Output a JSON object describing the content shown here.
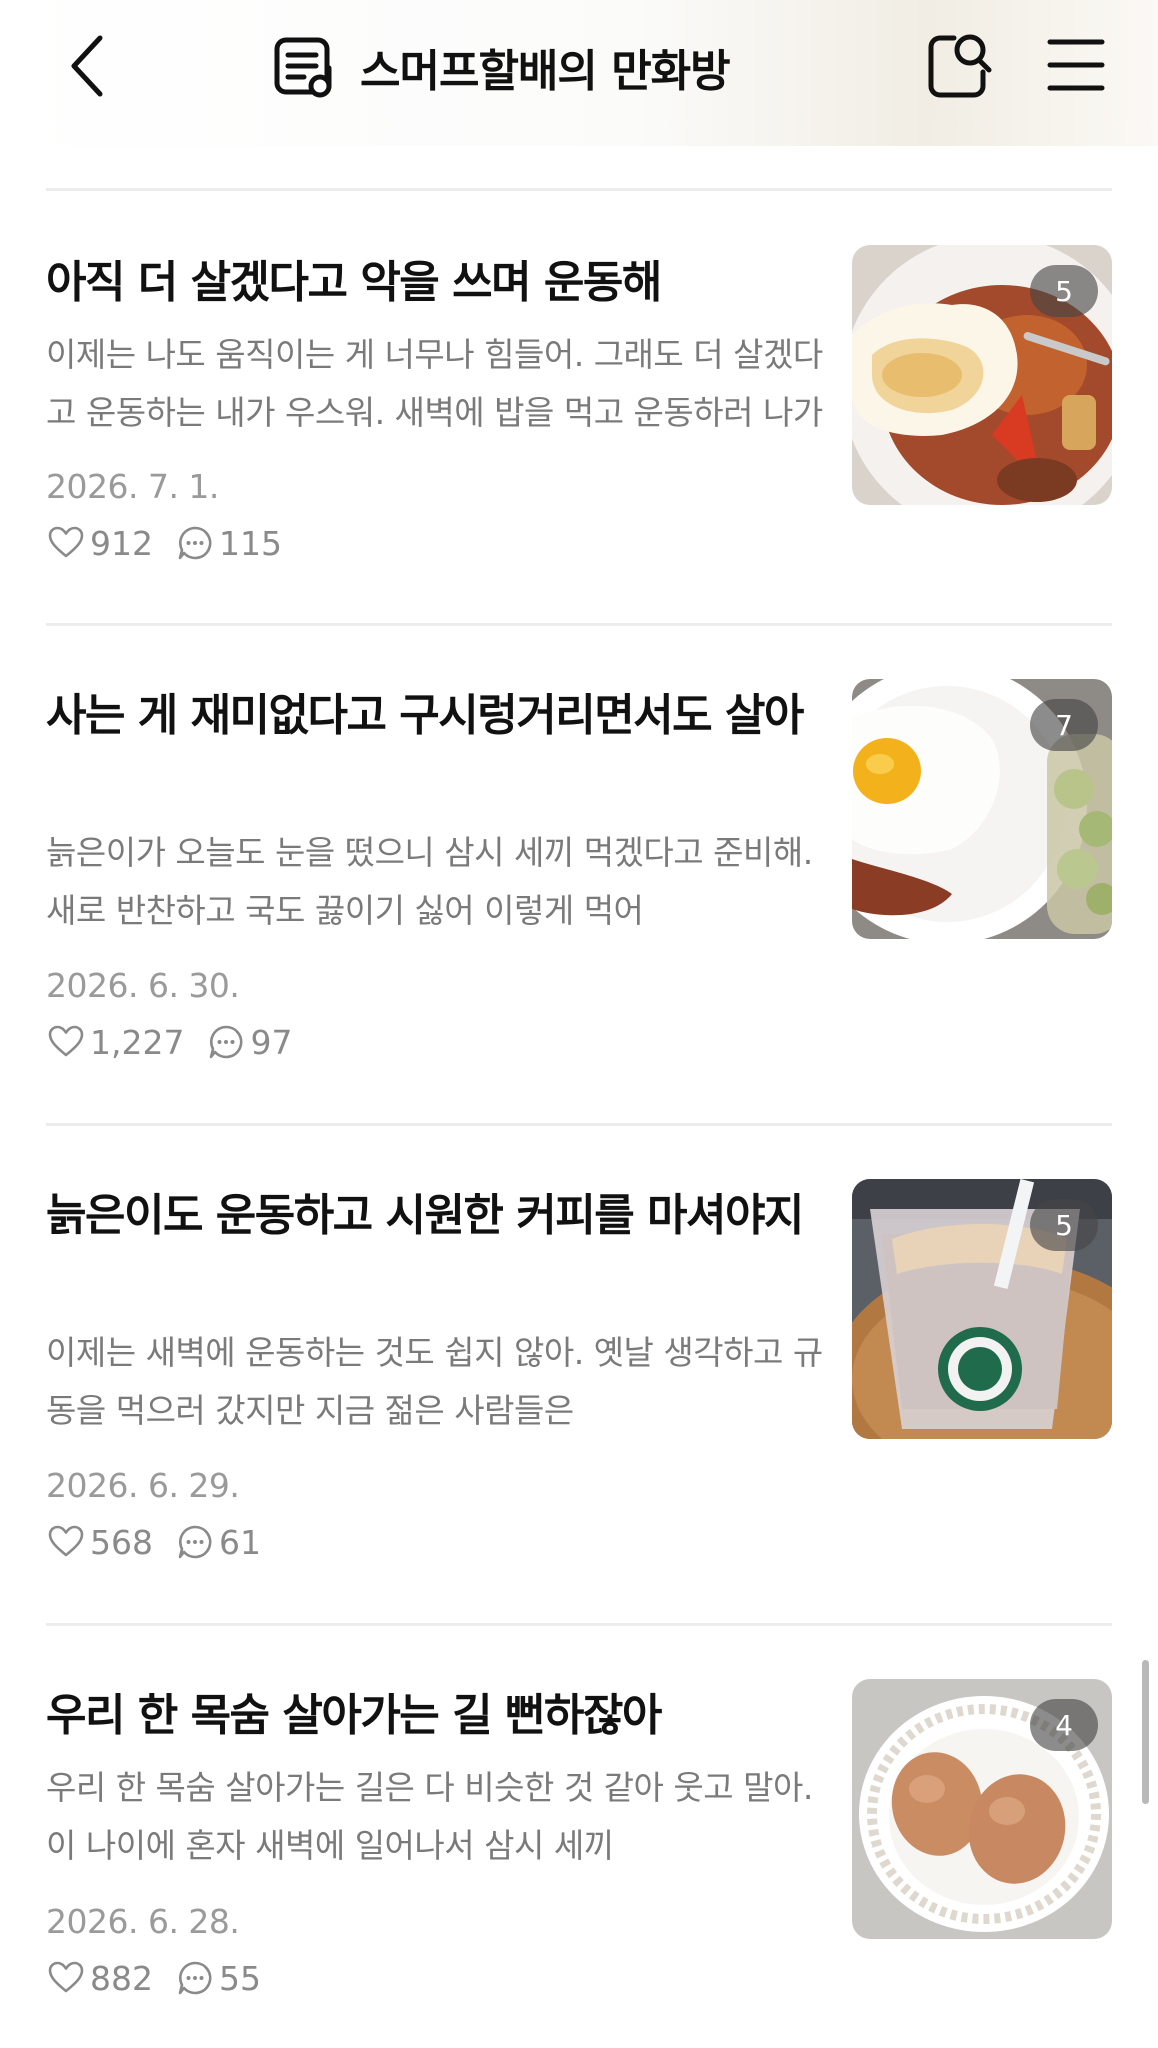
{
  "header": {
    "title": "스머프할배의 만화방",
    "back_icon": "chevron-left-icon",
    "list_icon": "post-list-icon",
    "search_icon": "search-icon",
    "menu_icon": "hamburger-menu-icon"
  },
  "posts": [
    {
      "title": "아직 더 살겠다고 악을 쓰며 운동해",
      "excerpt": "이제는 나도 움직이는 게 너무나 힘들어. 그래도 더 살겠다고 운동하는 내가 우스워. 새벽에 밥을 먹고 운동하러 나가",
      "date": "2026. 7. 1.",
      "likes": "912",
      "comments": "115",
      "image_count": "5"
    },
    {
      "title": "사는 게 재미없다고 구시렁거리면서도 살아",
      "excerpt": "늙은이가 오늘도 눈을 떴으니 삼시 세끼 먹겠다고 준비해. 새로 반찬하고 국도 끓이기 싫어 이렇게 먹어",
      "date": "2026. 6. 30.",
      "likes": "1,227",
      "comments": "97",
      "image_count": "7"
    },
    {
      "title": "늙은이도 운동하고 시원한 커피를 마셔야지",
      "excerpt": "이제는 새벽에 운동하는 것도 쉽지 않아. 옛날 생각하고 규동을 먹으러 갔지만 지금 젊은 사람들은",
      "date": "2026. 6. 29.",
      "likes": "568",
      "comments": "61",
      "image_count": "5"
    },
    {
      "title": "우리 한 목숨 살아가는 길 뻔하잖아",
      "excerpt": "우리 한 목숨 살아가는 길은 다 비슷한 것 같아 웃고 말아. 이 나이에 혼자 새벽에 일어나서 삼시 세끼",
      "date": "2026. 6. 28.",
      "likes": "882",
      "comments": "55",
      "image_count": "4"
    }
  ],
  "colors": {
    "title": "#111111",
    "excerpt": "#7a7a7a",
    "date": "#9a9a9a",
    "divider": "#ececec"
  }
}
